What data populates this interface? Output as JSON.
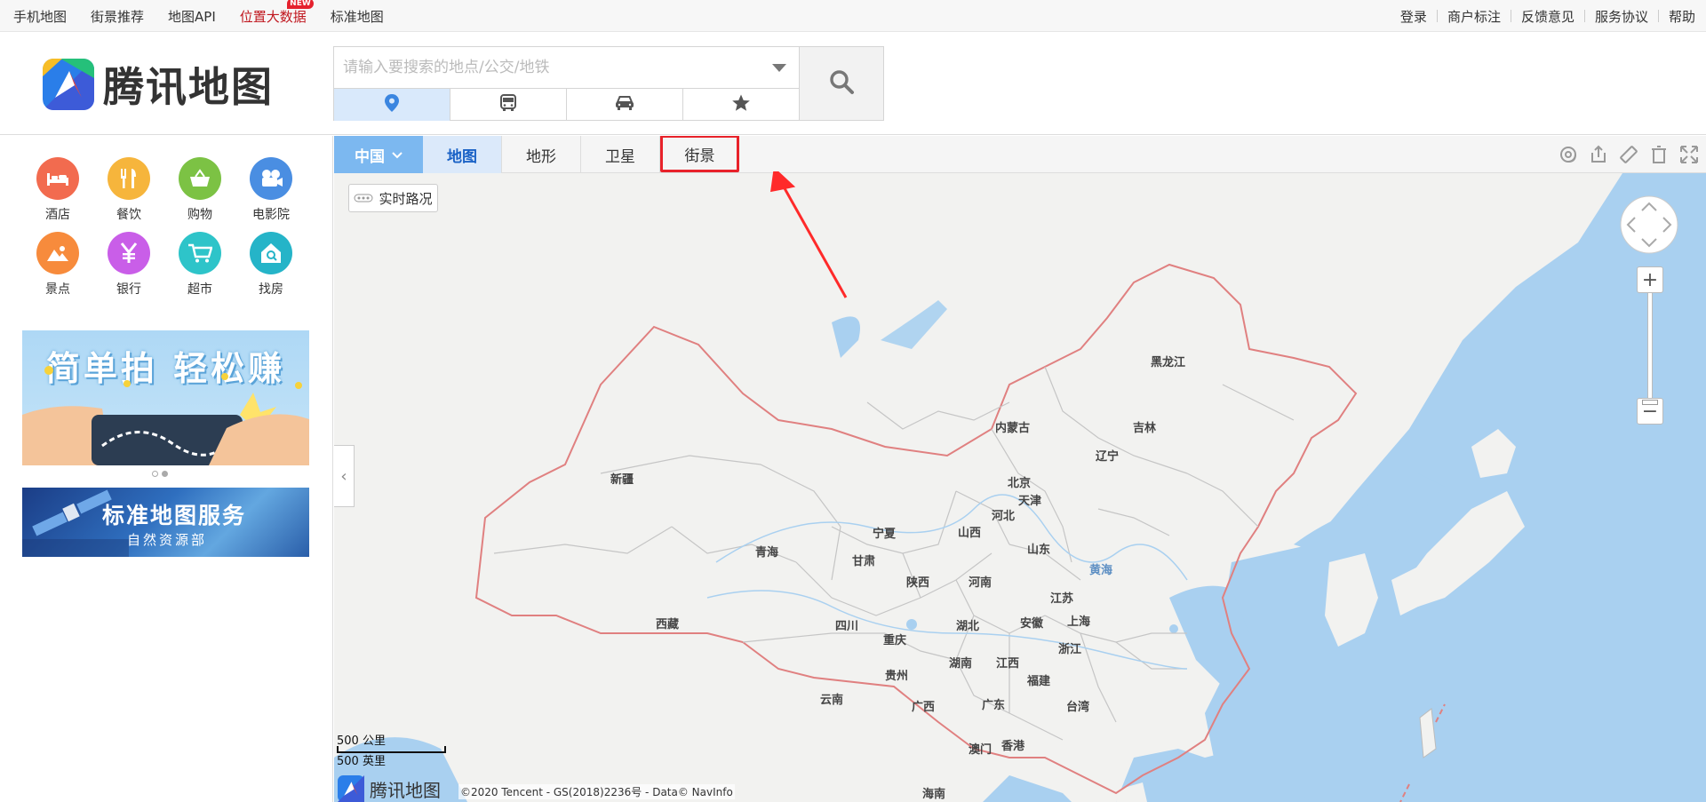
{
  "topbar": {
    "left_links": [
      "手机地图",
      "街景推荐",
      "地图API",
      "位置大数据",
      "标准地图"
    ],
    "new_badge": "NEW",
    "right_links": [
      "登录",
      "商户标注",
      "反馈意见",
      "服务协议",
      "帮助"
    ]
  },
  "brand": {
    "logo_text": "腾讯地图"
  },
  "search": {
    "placeholder": "请输入要搜索的地点/公交/地铁",
    "modes": [
      "place-icon",
      "bus-icon",
      "car-icon",
      "star-icon"
    ],
    "active_mode": 0
  },
  "categories": [
    {
      "label": "酒店",
      "color": "#f26b4f",
      "icon": "bed-icon"
    },
    {
      "label": "餐饮",
      "color": "#f6b53c",
      "icon": "fork-knife-icon"
    },
    {
      "label": "购物",
      "color": "#7cc244",
      "icon": "basket-icon"
    },
    {
      "label": "电影院",
      "color": "#4a8ee2",
      "icon": "film-camera-icon"
    },
    {
      "label": "景点",
      "color": "#f78b3c",
      "icon": "landscape-icon"
    },
    {
      "label": "银行",
      "color": "#c95ee8",
      "icon": "yen-icon"
    },
    {
      "label": "超市",
      "color": "#2ec4c9",
      "icon": "cart-icon"
    },
    {
      "label": "找房",
      "color": "#25b4c8",
      "icon": "house-icon"
    }
  ],
  "banners": {
    "promo_title": "简单拍 轻松赚",
    "std_title": "标准地图服务",
    "std_sub": "自然资源部",
    "dots": 2,
    "active_dot": 1
  },
  "map": {
    "region": "中国",
    "tabs": [
      "地图",
      "地形",
      "卫星",
      "街景"
    ],
    "active_tab": 0,
    "highlighted_tab": 3,
    "traffic_label": "实时路况",
    "scale_km": "500 公里",
    "scale_mi": "500 英里",
    "logo_text": "腾讯地图",
    "copyright": "©2020 Tencent - GS(2018)2236号 - Data© NavInfo",
    "tool_icons": [
      "locate-icon",
      "share-icon",
      "ruler-icon",
      "clear-icon",
      "fullscreen-icon"
    ],
    "labels": {
      "heilongjiang": "黑龙江",
      "neimenggu": "内蒙古",
      "jilin": "吉林",
      "liaoning": "辽宁",
      "xinjiang": "新疆",
      "beijing": "北京",
      "tianjin": "天津",
      "hebei": "河北",
      "ningxia": "宁夏",
      "shanxi": "山西",
      "shandong": "山东",
      "qinghai": "青海",
      "gansu": "甘肃",
      "shaanxi": "陕西",
      "henan": "河南",
      "huanghai": "黄海",
      "jiangsu": "江苏",
      "xizang": "西藏",
      "sichuan": "四川",
      "hubei": "湖北",
      "anhui": "安徽",
      "shanghai": "上海",
      "chongqing": "重庆",
      "zhejiang": "浙江",
      "hunan": "湖南",
      "jiangxi": "江西",
      "guizhou": "贵州",
      "fujian": "福建",
      "yunnan": "云南",
      "guangxi": "广西",
      "guangdong": "广东",
      "taiwan": "台湾",
      "aomen": "澳门",
      "xianggang": "香港",
      "hainan": "海南"
    }
  }
}
